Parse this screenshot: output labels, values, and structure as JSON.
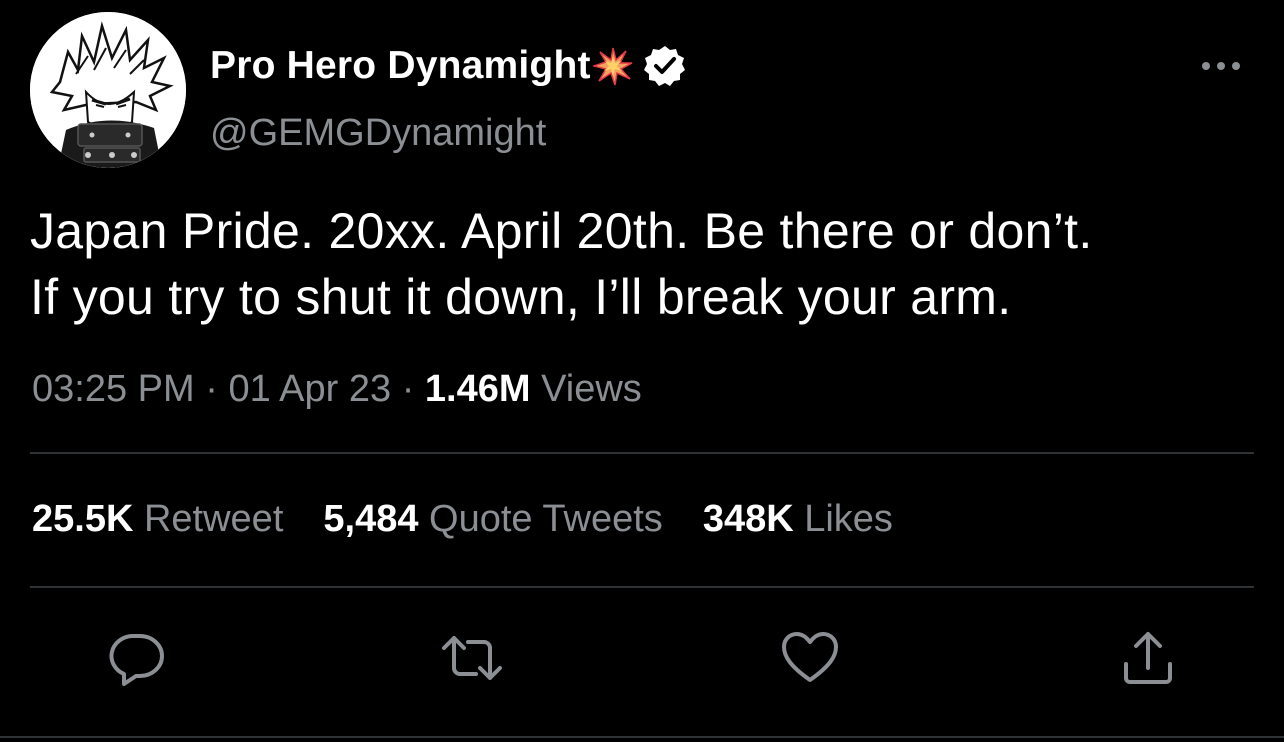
{
  "tweet": {
    "display_name": "Pro Hero Dynamight",
    "handle": "@GEMGDynamight",
    "text": "Japan Pride. 20xx. April 20th. Be there or don’t.\nIf you try to shut it down, I’ll break your arm.",
    "time": "03:25 PM",
    "separator": "·",
    "date": "01 Apr 23",
    "views_count": "1.46M",
    "views_label": "Views"
  },
  "stats": {
    "retweets_count": "25.5K",
    "retweets_label": "Retweet",
    "quotes_count": "5,484",
    "quotes_label": "Quote Tweets",
    "likes_count": "348K",
    "likes_label": "Likes"
  },
  "icons": {
    "name_emoji": "collision-icon",
    "verified": "verified-badge-icon",
    "more": "more-icon",
    "reply": "reply-icon",
    "retweet": "retweet-icon",
    "like": "heart-icon",
    "share": "share-icon"
  },
  "colors": {
    "background": "#000000",
    "text_primary": "#ffffff",
    "text_secondary": "#8b8f94",
    "divider": "#2f3336",
    "icon": "#8b8f94"
  }
}
